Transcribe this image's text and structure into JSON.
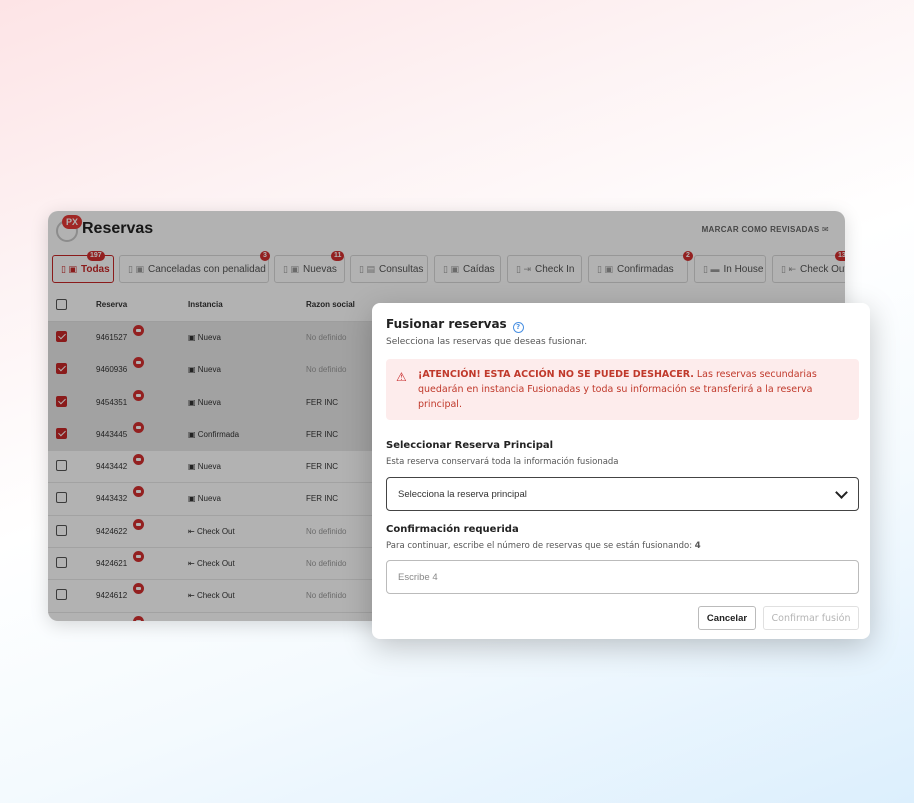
{
  "page": {
    "logo_badge": "PX",
    "title": "Reservas",
    "mark_reviewed": "MARCAR COMO REVISADAS",
    "mark_reviewed_icon": "envelope-open-icon"
  },
  "tabs": [
    {
      "label": "Todas",
      "count": "197"
    },
    {
      "label": "Canceladas con penalidad",
      "count": "3"
    },
    {
      "label": "Nuevas",
      "count": "11"
    },
    {
      "label": "Consultas",
      "count": ""
    },
    {
      "label": "Caídas",
      "count": ""
    },
    {
      "label": "Check In",
      "count": ""
    },
    {
      "label": "Confirmadas",
      "count": "2"
    },
    {
      "label": "In House",
      "count": ""
    },
    {
      "label": "Check Out",
      "count": "13"
    }
  ],
  "table": {
    "headers": {
      "reserva": "Reserva",
      "instancia": "Instancia",
      "razon": "Razon social"
    },
    "rows": [
      {
        "reserva": "9461527",
        "instancia": "Nueva",
        "razon": "No definido",
        "checked": true
      },
      {
        "reserva": "9460936",
        "instancia": "Nueva",
        "razon": "No definido",
        "checked": true
      },
      {
        "reserva": "9454351",
        "instancia": "Nueva",
        "razon": "FER INC",
        "checked": true
      },
      {
        "reserva": "9443445",
        "instancia": "Confirmada",
        "razon": "FER INC",
        "checked": true
      },
      {
        "reserva": "9443442",
        "instancia": "Nueva",
        "razon": "FER INC",
        "checked": false
      },
      {
        "reserva": "9443432",
        "instancia": "Nueva",
        "razon": "FER INC",
        "checked": false
      },
      {
        "reserva": "9424622",
        "instancia": "Check Out",
        "razon": "No definido",
        "checked": false
      },
      {
        "reserva": "9424621",
        "instancia": "Check Out",
        "razon": "No definido",
        "checked": false
      },
      {
        "reserva": "9424612",
        "instancia": "Check Out",
        "razon": "No definido",
        "checked": false
      }
    ]
  },
  "modal": {
    "title": "Fusionar reservas",
    "subtitle": "Selecciona las reservas que deseas fusionar.",
    "alert_strong": "¡ATENCIÓN! ESTA ACCIÓN NO SE PUEDE DESHACER.",
    "alert_text": " Las reservas secundarias quedarán en instancia Fusionadas y toda su información se transferirá a la reserva principal.",
    "principal_title": "Seleccionar Reserva Principal",
    "principal_desc": "Esta reserva conservará toda la información fusionada",
    "principal_placeholder": "Selecciona la reserva principal",
    "confirm_title": "Confirmación requerida",
    "confirm_desc": "Para continuar, escribe el número de reservas que se están fusionando:",
    "confirm_count": "4",
    "confirm_placeholder": "Escribe 4",
    "cancel_label": "Cancelar",
    "confirm_label": "Confirmar fusión"
  },
  "colors": {
    "accent": "#c62828",
    "alert_bg": "#fdecec",
    "info": "#4a90e2"
  }
}
